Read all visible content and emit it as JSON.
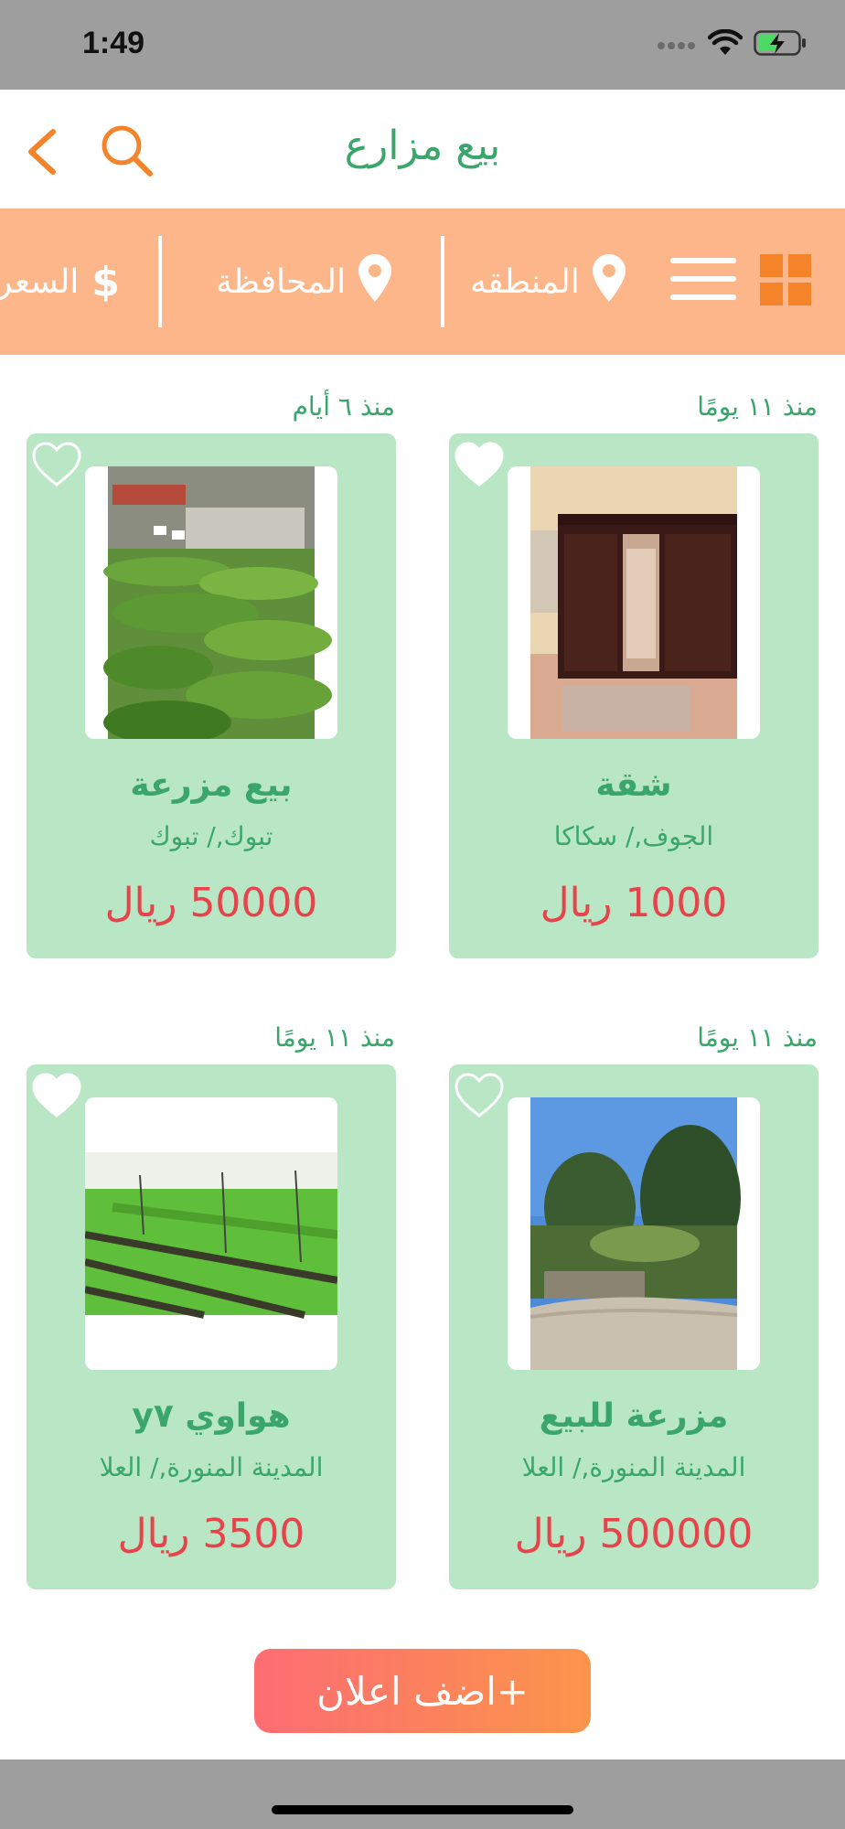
{
  "status_bar": {
    "time": "1:49"
  },
  "header": {
    "title": "بيع مزارع",
    "back_icon": "chevron-left-icon",
    "search_icon": "search-icon"
  },
  "filters": {
    "region": "المنطقه",
    "governorate": "المحافظة",
    "price": "السعر"
  },
  "colors": {
    "accent": "#f5832a",
    "filter_bar": "#fdb68a",
    "card_bg": "#b9e7c5",
    "text_green": "#3aa66b",
    "price_red": "#e8424b"
  },
  "listings": [
    {
      "time_ago": "منذ ١١ يومًا",
      "title": "شقة",
      "location": "الجوف,/ سكاكا",
      "price": "1000 ريال",
      "favorited": true
    },
    {
      "time_ago": "منذ ٦ أيام",
      "title": "بيع مزرعة",
      "location": "تبوك,/ تبوك",
      "price": "50000 ريال",
      "favorited": false
    },
    {
      "time_ago": "منذ ١١ يومًا",
      "title": "مزرعة للبيع",
      "location": "المدينة المنورة,/ العلا",
      "price": "500000 ريال",
      "favorited": false
    },
    {
      "time_ago": "منذ ١١ يومًا",
      "title": "هواوي y٧",
      "location": "المدينة المنورة,/ العلا",
      "price": "3500 ريال",
      "favorited": true
    }
  ],
  "add_button": {
    "label": "+اضف اعلان"
  }
}
